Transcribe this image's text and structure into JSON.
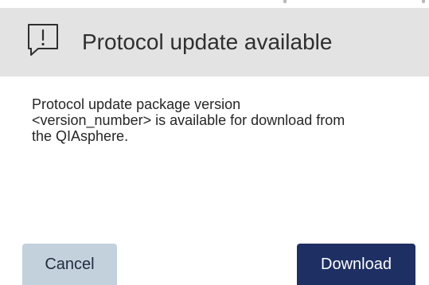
{
  "dialog": {
    "title": "Protocol update available",
    "icon": "speech-bubble-exclamation-icon",
    "message": "Protocol update package version\n<version_number> is available for download from\nthe QIAsphere.",
    "buttons": {
      "cancel_label": "Cancel",
      "download_label": "Download"
    }
  },
  "colors": {
    "header_bg": "#e3e3e3",
    "cancel_bg": "#c3d1dc",
    "download_bg": "#1e2f63",
    "download_text": "#ffffff"
  }
}
